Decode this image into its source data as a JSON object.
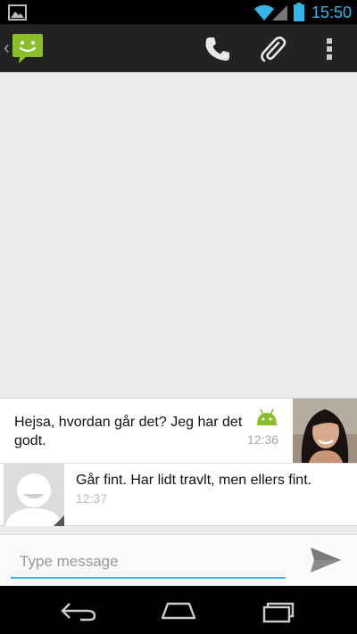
{
  "status_bar": {
    "time": "15:50",
    "accent_color": "#33b5e5",
    "icons": [
      "gallery-notification-icon",
      "wifi-icon",
      "signal-icon",
      "battery-icon"
    ]
  },
  "action_bar": {
    "logo": "messaging-app-icon",
    "actions": [
      "call-icon",
      "attach-icon",
      "overflow-menu-icon"
    ]
  },
  "messages": [
    {
      "text": "Hejsa, hvordan går det? Jeg har det godt.",
      "time": "12:36",
      "status_icon": "android-icon",
      "avatar": "contact-photo"
    },
    {
      "text": "Går fint. Har lidt travlt, men ellers fint.",
      "time": "12:37",
      "avatar": "default-avatar"
    }
  ],
  "compose": {
    "placeholder": "Type message",
    "value": ""
  },
  "nav_bar": {
    "buttons": [
      "back-icon",
      "home-icon",
      "recent-apps-icon"
    ]
  }
}
